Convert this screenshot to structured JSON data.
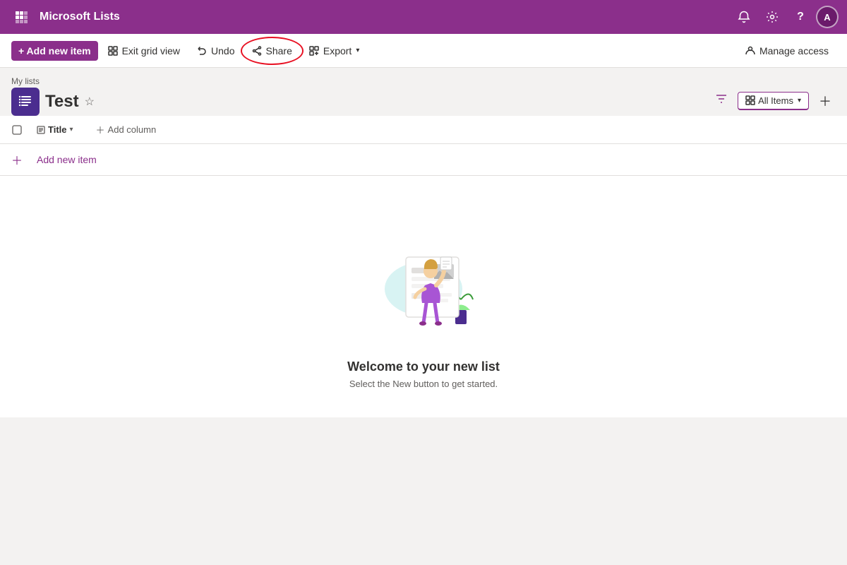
{
  "app": {
    "title": "Microsoft Lists"
  },
  "nav": {
    "grid_icon": "⊞",
    "notification_label": "Notifications",
    "settings_label": "Settings",
    "help_label": "Help",
    "avatar_label": "A"
  },
  "toolbar": {
    "add_new_item": "+ Add new item",
    "exit_grid_view": "Exit grid view",
    "undo": "Undo",
    "share": "Share",
    "export": "Export",
    "manage_access": "Manage access"
  },
  "header": {
    "breadcrumb": "My lists",
    "title": "Test",
    "star_label": "Favorite",
    "view_label": "All Items",
    "filter_label": "Filter",
    "add_view_label": "Add view"
  },
  "columns": {
    "title": "Title",
    "add_column": "Add column"
  },
  "list": {
    "add_new_item": "Add new item"
  },
  "empty_state": {
    "title": "Welcome to your new list",
    "subtitle": "Select the New button to get started."
  }
}
